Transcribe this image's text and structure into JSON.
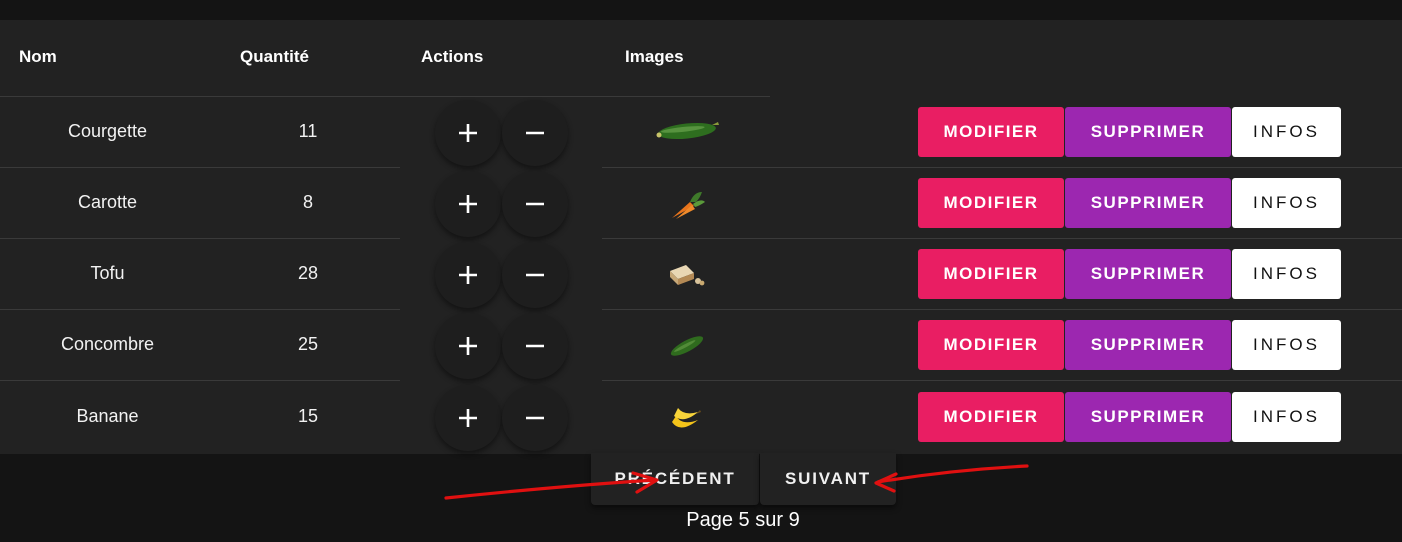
{
  "table": {
    "headers": {
      "name": "Nom",
      "quantity": "Quantité",
      "actions": "Actions",
      "images": "Images"
    },
    "rows": [
      {
        "name": "Courgette",
        "quantity": "11",
        "image_icon": "zucchini-icon"
      },
      {
        "name": "Carotte",
        "quantity": "8",
        "image_icon": "carrot-icon"
      },
      {
        "name": "Tofu",
        "quantity": "28",
        "image_icon": "tofu-icon"
      },
      {
        "name": "Concombre",
        "quantity": "25",
        "image_icon": "cucumber-icon"
      },
      {
        "name": "Banane",
        "quantity": "15",
        "image_icon": "banana-icon"
      }
    ],
    "row_buttons": {
      "modifier": "MODIFIER",
      "supprimer": "SUPPRIMER",
      "infos": "INFOS"
    }
  },
  "pagination": {
    "previous_label": "PRÉCÉDENT",
    "next_label": "SUIVANT",
    "page_info": "Page 5 sur 9"
  },
  "colors": {
    "modifier": "#e91e63",
    "supprimer": "#9c27b0",
    "infos": "#ffffff",
    "annotation_arrows": "#e01010"
  }
}
